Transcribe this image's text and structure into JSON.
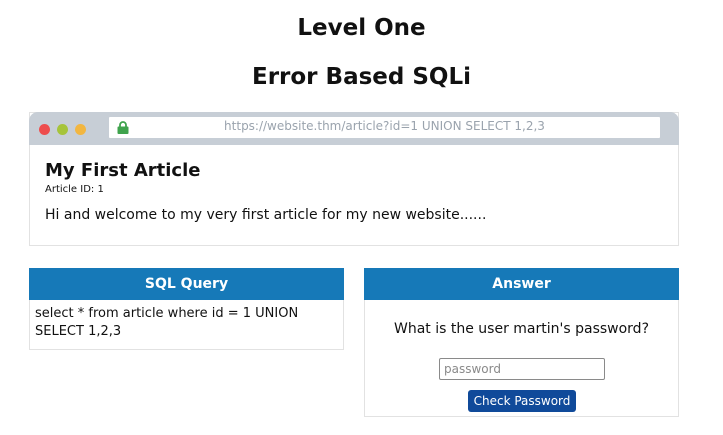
{
  "page": {
    "level_title": "Level One",
    "subtitle": "Error Based SQLi"
  },
  "browser": {
    "url": "https://website.thm/article?id=1 UNION SELECT 1,2,3",
    "window_dots": [
      "red",
      "green",
      "orange"
    ],
    "lock_icon": "padlock-icon"
  },
  "article": {
    "title": "My First Article",
    "id_label": "Article ID: 1",
    "body": "Hi and welcome to my very first article for my new website......"
  },
  "sql_panel": {
    "header": "SQL Query",
    "query": "select * from article where id = 1 UNION SELECT 1,2,3"
  },
  "answer_panel": {
    "header": "Answer",
    "question": "What is the user martin's password?",
    "password_placeholder": "password",
    "button_label": "Check Password"
  },
  "colors": {
    "panel_header": "#1679b8",
    "button": "#104a9a",
    "browser_bar": "#c7ced6",
    "lock": "#3fa34d"
  }
}
